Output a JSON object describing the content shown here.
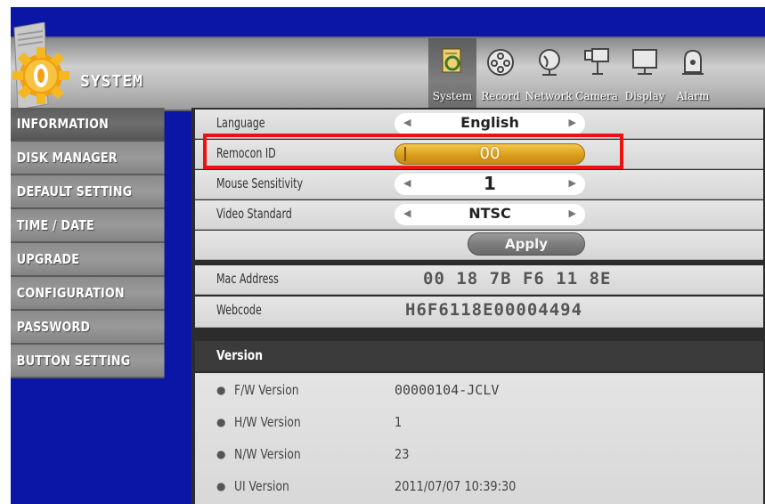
{
  "app": {
    "title": "SYSTEM"
  },
  "menu": [
    {
      "label": "System",
      "icon": "system-icon"
    },
    {
      "label": "Record",
      "icon": "record-icon"
    },
    {
      "label": "Network",
      "icon": "network-icon"
    },
    {
      "label": "Camera",
      "icon": "camera-icon"
    },
    {
      "label": "Display",
      "icon": "display-icon"
    },
    {
      "label": "Alarm",
      "icon": "alarm-icon"
    }
  ],
  "sidebar": {
    "items": [
      {
        "label": "INFORMATION"
      },
      {
        "label": "DISK MANAGER"
      },
      {
        "label": "DEFAULT SETTING"
      },
      {
        "label": "TIME / DATE"
      },
      {
        "label": "UPGRADE"
      },
      {
        "label": "CONFIGURATION"
      },
      {
        "label": "PASSWORD"
      },
      {
        "label": "BUTTON SETTING"
      }
    ]
  },
  "settings": {
    "language": {
      "label": "Language",
      "value": "English"
    },
    "remocon": {
      "label": "Remocon ID",
      "value": "00"
    },
    "mouse": {
      "label": "Mouse Sensitivity",
      "value": "1"
    },
    "video": {
      "label": "Video Standard",
      "value": "NTSC"
    },
    "apply_label": "Apply",
    "mac": {
      "label": "Mac Address",
      "value": "00 18 7B F6 11 8E"
    },
    "webcode": {
      "label": "Webcode",
      "value": "H6F6118E00004494"
    }
  },
  "version": {
    "header": "Version",
    "fw": {
      "label": "F/W Version",
      "value": "00000104-JCLV"
    },
    "hw": {
      "label": "H/W Version",
      "value": "1"
    },
    "nw": {
      "label": "N/W Version",
      "value": "23"
    },
    "ui": {
      "label": "UI Version",
      "value": "2011/07/07 10:39:30"
    }
  },
  "colors": {
    "screen_bg": "#0b16a6",
    "highlight": "#ee1111",
    "remocon_accent": "#d89a19"
  }
}
